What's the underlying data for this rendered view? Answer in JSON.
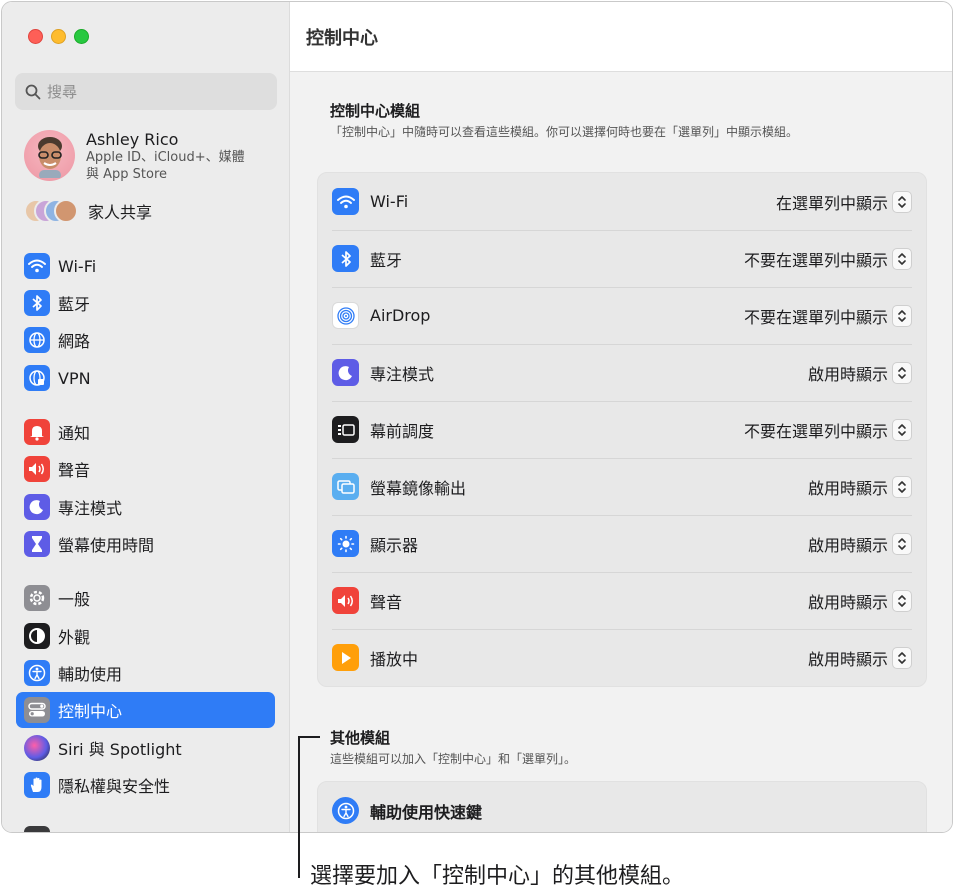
{
  "window": {
    "title": "控制中心"
  },
  "sidebar": {
    "search_placeholder": "搜尋",
    "account": {
      "name": "Ashley Rico",
      "subtitle_line1": "Apple ID、iCloud+、媒體",
      "subtitle_line2": "與 App Store"
    },
    "family_label": "家人共享",
    "items": [
      {
        "label": "Wi-Fi",
        "icon": "wifi-icon",
        "color": "#2f7cf6"
      },
      {
        "label": "藍牙",
        "icon": "bluetooth-icon",
        "color": "#2f7cf6"
      },
      {
        "label": "網路",
        "icon": "globe-icon",
        "color": "#2f7cf6"
      },
      {
        "label": "VPN",
        "icon": "vpn-globe-icon",
        "color": "#2f7cf6"
      },
      {
        "label": "通知",
        "icon": "bell-icon",
        "color": "#f0433a"
      },
      {
        "label": "聲音",
        "icon": "speaker-icon",
        "color": "#f0433a"
      },
      {
        "label": "專注模式",
        "icon": "moon-icon",
        "color": "#5e5ce6"
      },
      {
        "label": "螢幕使用時間",
        "icon": "hourglass-icon",
        "color": "#5e5ce6"
      },
      {
        "label": "一般",
        "icon": "gear-icon",
        "color": "#8e8e93"
      },
      {
        "label": "外觀",
        "icon": "appearance-icon",
        "color": "#1d1d1f"
      },
      {
        "label": "輔助使用",
        "icon": "accessibility-icon",
        "color": "#2f7cf6"
      },
      {
        "label": "控制中心",
        "icon": "control-center-icon",
        "color": "#8e8e93"
      },
      {
        "label": "Siri 與 Spotlight",
        "icon": "siri-icon",
        "color": "#1d1d1f"
      },
      {
        "label": "隱私權與安全性",
        "icon": "hand-icon",
        "color": "#2f7cf6"
      }
    ],
    "active_index": 11
  },
  "main": {
    "header_title": "控制中心",
    "modules_section": {
      "title": "控制中心模組",
      "description": "「控制中心」中隨時可以查看這些模組。你可以選擇何時也要在「選單列」中顯示模組。"
    },
    "modules": [
      {
        "name": "Wi-Fi",
        "value": "在選單列中顯示",
        "icon": "wifi-icon",
        "color": "#2f7cf6"
      },
      {
        "name": "藍牙",
        "value": "不要在選單列中顯示",
        "icon": "bluetooth-icon",
        "color": "#2f7cf6"
      },
      {
        "name": "AirDrop",
        "value": "不要在選單列中顯示",
        "icon": "airdrop-icon",
        "color": "#ffffff"
      },
      {
        "name": "專注模式",
        "value": "啟用時顯示",
        "icon": "moon-icon",
        "color": "#5e5ce6"
      },
      {
        "name": "幕前調度",
        "value": "不要在選單列中顯示",
        "icon": "stage-manager-icon",
        "color": "#1d1d1f"
      },
      {
        "name": "螢幕鏡像輸出",
        "value": "啟用時顯示",
        "icon": "screen-mirroring-icon",
        "color": "#5aaef0"
      },
      {
        "name": "顯示器",
        "value": "啟用時顯示",
        "icon": "sun-icon",
        "color": "#2f7cf6"
      },
      {
        "name": "聲音",
        "value": "啟用時顯示",
        "icon": "speaker-icon",
        "color": "#f0433a"
      },
      {
        "name": "播放中",
        "value": "啟用時顯示",
        "icon": "play-icon",
        "color": "#ff9f0a"
      }
    ],
    "other_section": {
      "title": "其他模組",
      "description": "這些模組可以加入「控制中心」和「選單列」。"
    },
    "other_modules": [
      {
        "name": "輔助使用快速鍵",
        "icon": "accessibility-icon",
        "color": "#2f7cf6"
      }
    ]
  },
  "callout": {
    "text": "選擇要加入「控制中心」的其他模組。"
  }
}
